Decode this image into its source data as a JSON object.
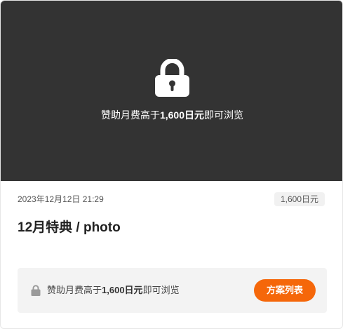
{
  "cover": {
    "lock_icon": "lock-icon",
    "text_prefix": "赞助月费高于",
    "text_amount": "1,600日元",
    "text_suffix": "即可浏览"
  },
  "post": {
    "date": "2023年12月12日 21:29",
    "price_badge": "1,600日元",
    "title": "12月特典 / photo"
  },
  "paywall": {
    "lock_icon": "lock-icon",
    "text_prefix": "赞助月费高于",
    "text_amount": "1,600日元",
    "text_suffix": "即可浏览",
    "button_label": "方案列表"
  },
  "colors": {
    "cover_bg": "#333333",
    "accent": "#f5670a",
    "paywall_bg": "#f3f3f3"
  }
}
